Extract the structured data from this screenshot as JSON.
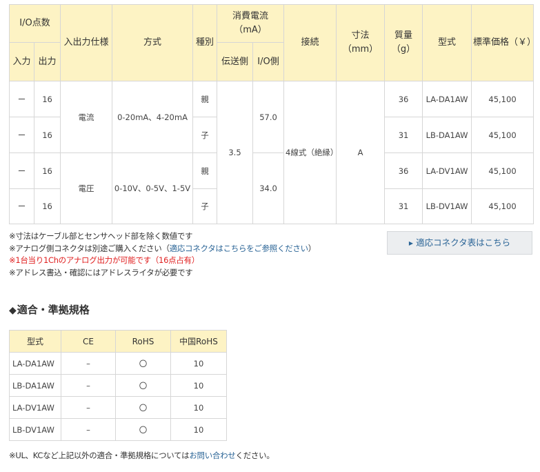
{
  "spec": {
    "headers": {
      "io_points": "I/O点数",
      "input": "入力",
      "output": "出力",
      "io_spec": "入出力仕様",
      "method": "方式",
      "kind": "種別",
      "power": "消費電流（mA）",
      "transmit_side": "伝送側",
      "io_side": "I/O側",
      "connection": "接続",
      "dimension": "寸法（mm）",
      "mass": "質量（g）",
      "model": "型式",
      "price": "標準価格（￥）"
    },
    "rows": [
      {
        "input": "ー",
        "output": "16",
        "kind": "親",
        "mass": "36",
        "model": "LA-DA1AW",
        "price": "45,100"
      },
      {
        "input": "ー",
        "output": "16",
        "kind": "子",
        "mass": "31",
        "model": "LB-DA1AW",
        "price": "45,100"
      },
      {
        "input": "ー",
        "output": "16",
        "kind": "親",
        "mass": "36",
        "model": "LA-DV1AW",
        "price": "45,100"
      },
      {
        "input": "ー",
        "output": "16",
        "kind": "子",
        "mass": "31",
        "model": "LB-DV1AW",
        "price": "45,100"
      }
    ],
    "groups": [
      {
        "io_spec": "電流",
        "method": "0-20mA、4-20mA",
        "io_side": "57.0"
      },
      {
        "io_spec": "電圧",
        "method": "0-10V、0-5V、1-5V",
        "io_side": "34.0"
      }
    ],
    "transmit_side": "3.5",
    "connection": "4線式（絶縁）",
    "dimension": "A"
  },
  "notes": {
    "n1": "※寸法はケーブル部とセンサヘッド部を除く数値です",
    "n2_prefix": "※アナログ側コネクタは別途ご購入ください（",
    "n2_link": "適応コネクタはこちらをご参照ください",
    "n2_suffix": "）",
    "n3": "※1台当り1Chのアナログ出力が可能です（16点占有）",
    "n4": "※アドレス書込・確認にはアドレスライタが必要です"
  },
  "connector_button": "適応コネクタ表はこちら",
  "standards": {
    "title": "適合・準拠規格",
    "headers": [
      "型式",
      "CE",
      "RoHS",
      "中国RoHS"
    ],
    "rows": [
      {
        "model": "LA-DA1AW",
        "ce": "–",
        "rohs": "〇",
        "china_rohs": "10"
      },
      {
        "model": "LB-DA1AW",
        "ce": "–",
        "rohs": "〇",
        "china_rohs": "10"
      },
      {
        "model": "LA-DV1AW",
        "ce": "–",
        "rohs": "〇",
        "china_rohs": "10"
      },
      {
        "model": "LB-DV1AW",
        "ce": "–",
        "rohs": "〇",
        "china_rohs": "10"
      }
    ]
  },
  "footer": {
    "prefix": "※UL、KCなど上記以外の適合・準拠規格については",
    "link": "お問い合わせ",
    "suffix": "ください。"
  }
}
